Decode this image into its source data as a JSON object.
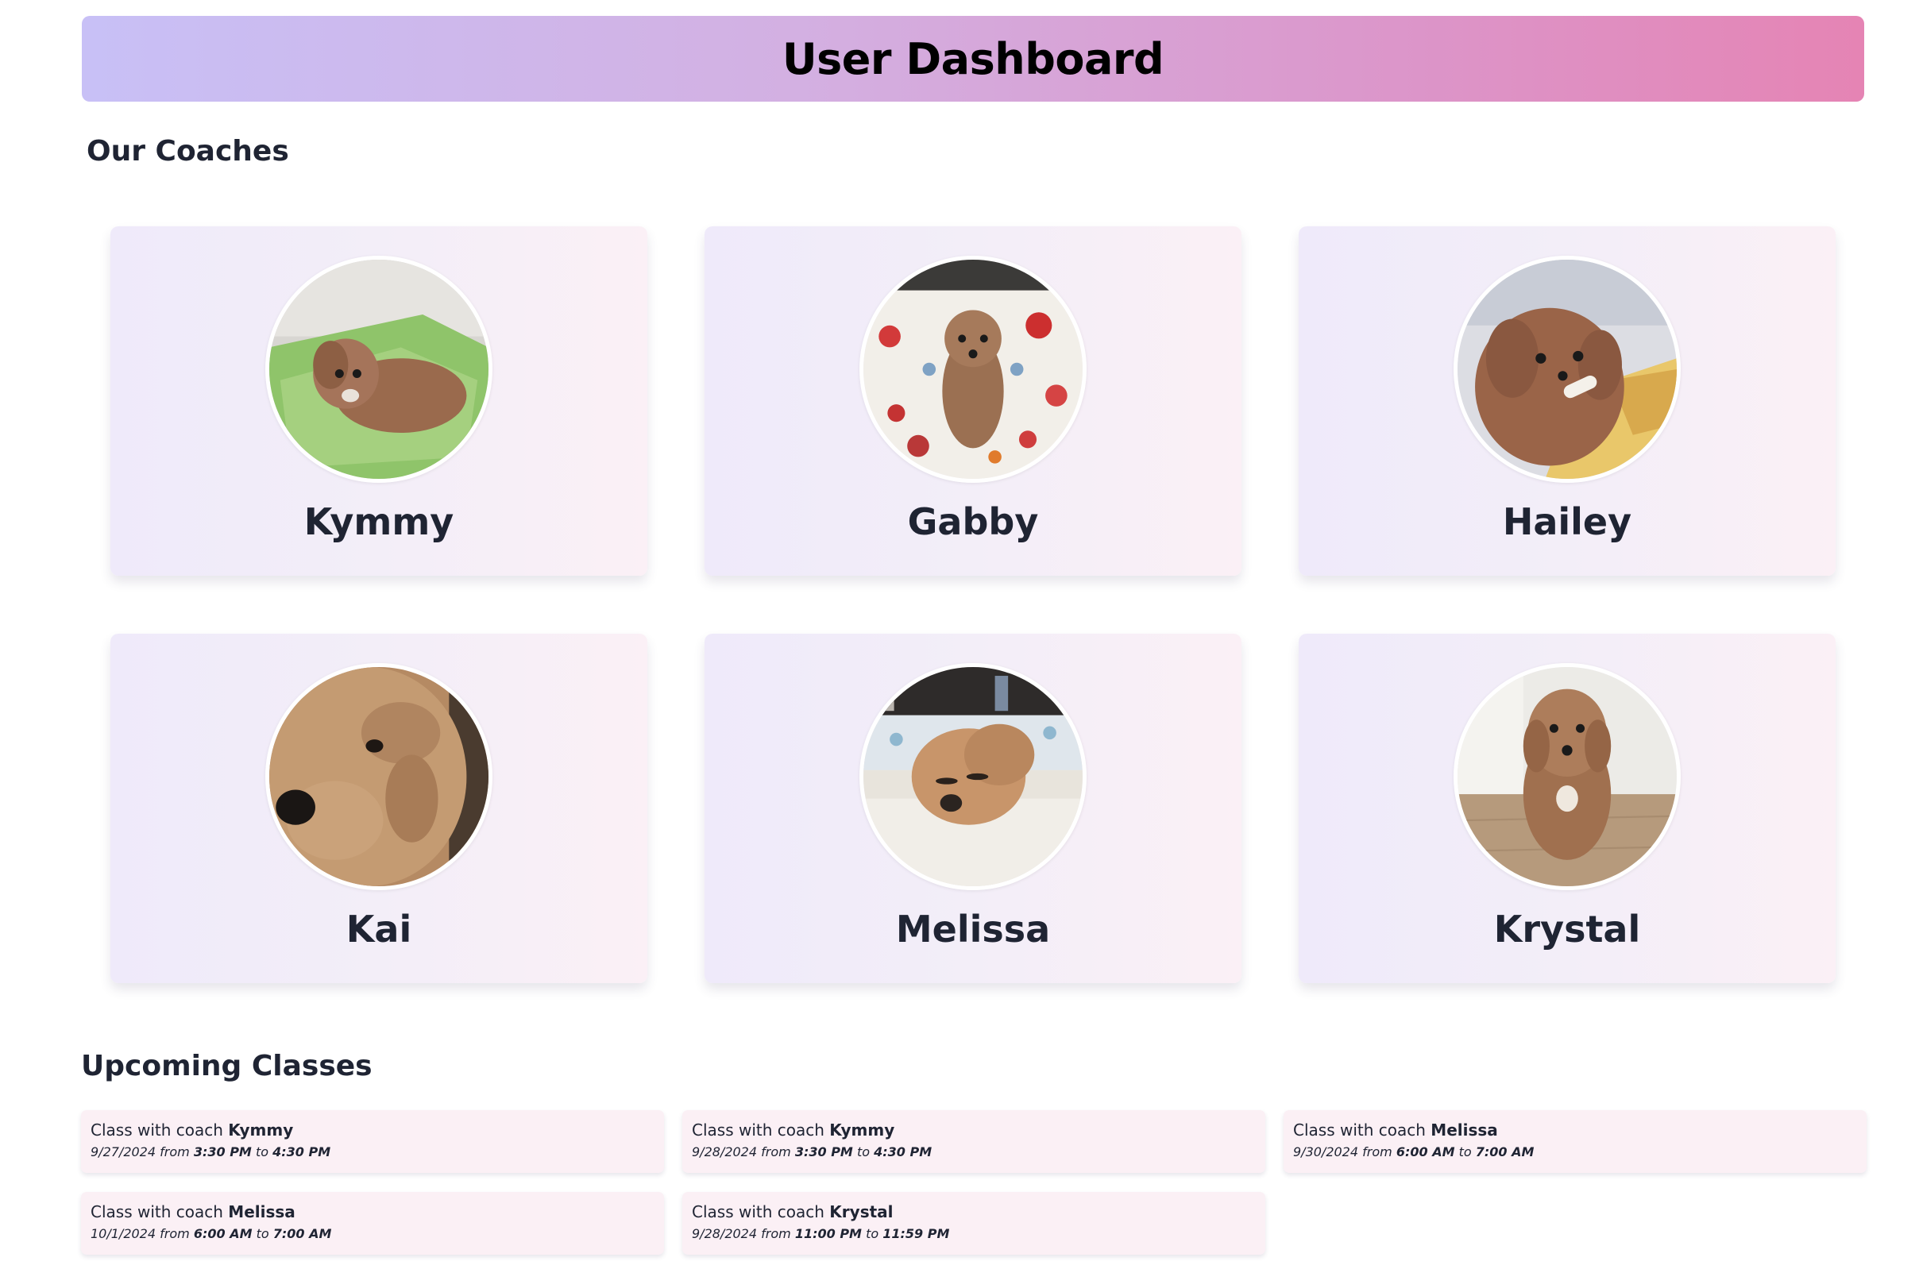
{
  "header": {
    "title": "User Dashboard"
  },
  "coaches_section": {
    "title": "Our Coaches"
  },
  "coaches": [
    {
      "name": "Kymmy"
    },
    {
      "name": "Gabby"
    },
    {
      "name": "Hailey"
    },
    {
      "name": "Kai"
    },
    {
      "name": "Melissa"
    },
    {
      "name": "Krystal"
    }
  ],
  "classes_section": {
    "title": "Upcoming Classes"
  },
  "classes": [
    {
      "prefix": "Class with coach",
      "coach": "Kymmy",
      "date": "9/27/2024",
      "from_word": "from",
      "start": "3:30 PM",
      "to_word": "to",
      "end": "4:30 PM"
    },
    {
      "prefix": "Class with coach",
      "coach": "Kymmy",
      "date": "9/28/2024",
      "from_word": "from",
      "start": "3:30 PM",
      "to_word": "to",
      "end": "4:30 PM"
    },
    {
      "prefix": "Class with coach",
      "coach": "Melissa",
      "date": "9/30/2024",
      "from_word": "from",
      "start": "6:00 AM",
      "to_word": "to",
      "end": "7:00 AM"
    },
    {
      "prefix": "Class with coach",
      "coach": "Melissa",
      "date": "10/1/2024",
      "from_word": "from",
      "start": "6:00 AM",
      "to_word": "to",
      "end": "7:00 AM"
    },
    {
      "prefix": "Class with coach",
      "coach": "Krystal",
      "date": "9/28/2024",
      "from_word": "from",
      "start": "11:00 PM",
      "to_word": "to",
      "end": "11:59 PM"
    }
  ],
  "colors": {
    "header_gradient_start": "#c8c0f6",
    "header_gradient_end": "#e584b4",
    "card_bg": "#f3eef8",
    "class_card_bg": "#fbf0f5",
    "text": "#1f2433"
  }
}
